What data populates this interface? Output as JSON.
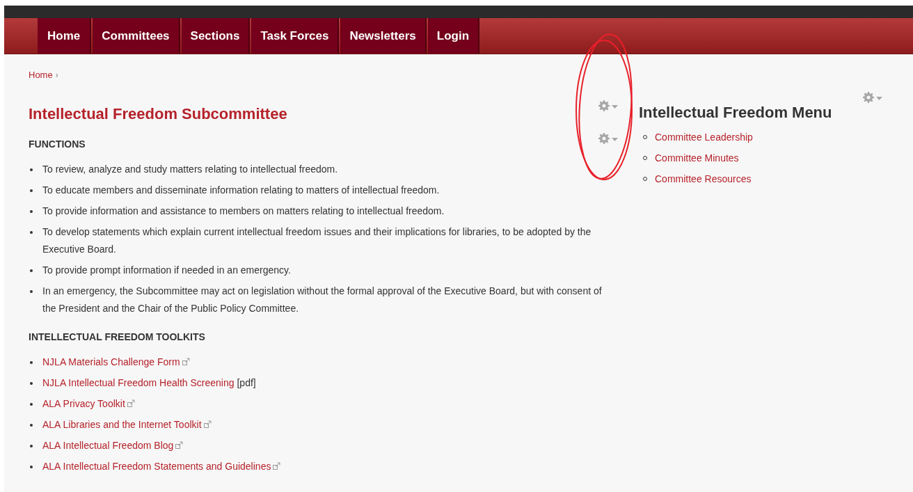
{
  "nav": [
    {
      "label": "Home",
      "selected": false
    },
    {
      "label": "Committees",
      "selected": false
    },
    {
      "label": "Sections",
      "selected": false
    },
    {
      "label": "Task Forces",
      "selected": false
    },
    {
      "label": "Newsletters",
      "selected": false
    },
    {
      "label": "Login",
      "selected": false
    }
  ],
  "breadcrumb": {
    "items": [
      "Home"
    ],
    "separator": "›"
  },
  "main": {
    "title": "Intellectual Freedom Subcommittee",
    "sections": [
      {
        "heading": "FUNCTIONS",
        "items": [
          {
            "text": "To review, analyze and study matters relating to intellectual freedom."
          },
          {
            "text": "To educate members and disseminate information relating to matters of intellectual freedom."
          },
          {
            "text": "To provide information and assistance to members on matters relating to intellectual freedom."
          },
          {
            "text": "To develop statements which explain current intellectual freedom issues and their implications for libraries, to be adopted by the Executive Board."
          },
          {
            "text": "To provide prompt information if needed in an emergency."
          },
          {
            "text": "In an emergency, the Subcommittee may act on legislation without the formal approval of the Executive Board, but with consent of the President and the Chair of the Public Policy Committee."
          }
        ]
      },
      {
        "heading": "INTELLECTUAL FREEDOM TOOLKITS",
        "links": [
          {
            "text": "NJLA Materials Challenge Form",
            "external": true
          },
          {
            "text": "NJLA Intellectual Freedom Health Screening",
            "external": false,
            "suffix": "[pdf]"
          },
          {
            "text": "ALA Privacy Toolkit",
            "external": true
          },
          {
            "text": "ALA Libraries and the Internet Toolkit",
            "external": true
          },
          {
            "text": "ALA Intellectual Freedom Blog",
            "external": true
          },
          {
            "text": "ALA Intellectual Freedom Statements and Guidelines",
            "external": true
          }
        ]
      }
    ]
  },
  "sidebar": {
    "title": "Intellectual Freedom Menu",
    "items": [
      "Committee Leadership",
      "Committee Minutes",
      "Committee Resources"
    ]
  }
}
